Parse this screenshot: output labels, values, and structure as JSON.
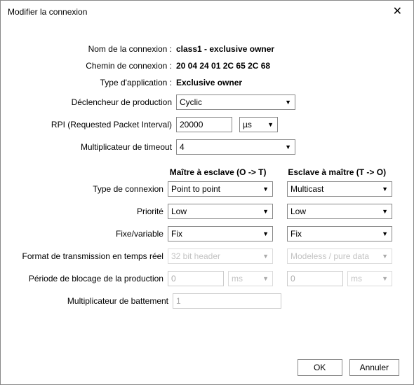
{
  "title": "Modifier la connexion",
  "labels": {
    "connName": "Nom de la connexion :",
    "connPath": "Chemin de connexion :",
    "appType": "Type d'application :",
    "trigger": "Déclencheur de production",
    "rpi": "RPI (Requested Packet Interval)",
    "timeoutMult": "Multiplicateur de timeout",
    "connType": "Type de connexion",
    "priority": "Priorité",
    "fixVar": "Fixe/variable",
    "rtFormat": "Format de transmission en temps réel",
    "blockPeriod": "Période de blocage de la production",
    "heartbeatMult": "Multiplicateur de battement"
  },
  "values": {
    "connName": "class1 - exclusive owner",
    "connPath": "20 04 24 01 2C 65 2C 68",
    "appType": "Exclusive owner",
    "trigger": "Cyclic",
    "rpi": "20000",
    "rpiUnit": "µs",
    "timeoutMult": "4",
    "heartbeatMult": "1"
  },
  "headers": {
    "m2s": "Maître à esclave (O -> T)",
    "s2m": "Esclave à maître (T -> O)"
  },
  "m2s": {
    "connType": "Point to point",
    "priority": "Low",
    "fixVar": "Fix",
    "rtFormat": "32 bit header",
    "blockPeriod": "0",
    "blockUnit": "ms"
  },
  "s2m": {
    "connType": "Multicast",
    "priority": "Low",
    "fixVar": "Fix",
    "rtFormat": "Modeless / pure data",
    "blockPeriod": "0",
    "blockUnit": "ms"
  },
  "buttons": {
    "ok": "OK",
    "cancel": "Annuler"
  }
}
